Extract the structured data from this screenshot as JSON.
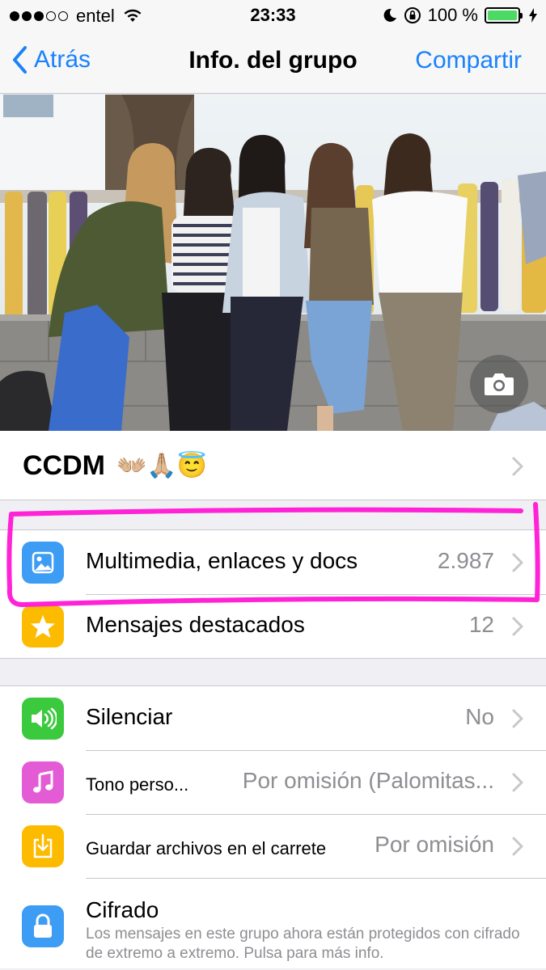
{
  "status_bar": {
    "carrier": "entel",
    "time": "23:33",
    "battery_percent_label": "100 %",
    "battery_level": 1.0,
    "signal_bars_filled": 3,
    "signal_bars_total": 5
  },
  "nav": {
    "back_label": "Atrás",
    "title": "Info. del grupo",
    "action_label": "Compartir"
  },
  "group": {
    "name": "CCDM",
    "emoji": "👐🏼🙏🏼😇"
  },
  "media_section": [
    {
      "label": "Multimedia, enlaces y docs",
      "value": "2.987",
      "icon": "photo-icon",
      "color": "#3d9cf3"
    },
    {
      "label": "Mensajes destacados",
      "value": "12",
      "icon": "star-icon",
      "color": "#fdbb00"
    }
  ],
  "settings_section": {
    "mute": {
      "label": "Silenciar",
      "value": "No",
      "icon": "speaker-icon",
      "color": "#3bca3e"
    },
    "tone": {
      "label": "Tono perso...",
      "value": "Por omisión (Palomitas...",
      "icon": "music-note-icon",
      "color": "#e45bd6"
    },
    "save": {
      "label": "Guardar archivos en el carrete",
      "value": "Por omisión",
      "icon": "download-icon",
      "color": "#fdbb00"
    },
    "encryption": {
      "label": "Cifrado",
      "description": "Los mensajes en este grupo ahora están protegidos con cifrado de extremo a extremo. Pulsa para más info.",
      "icon": "lock-icon",
      "color": "#3d9cf3"
    }
  },
  "colors": {
    "accent": "#1a82fb",
    "annotation": "#ff22d6"
  }
}
